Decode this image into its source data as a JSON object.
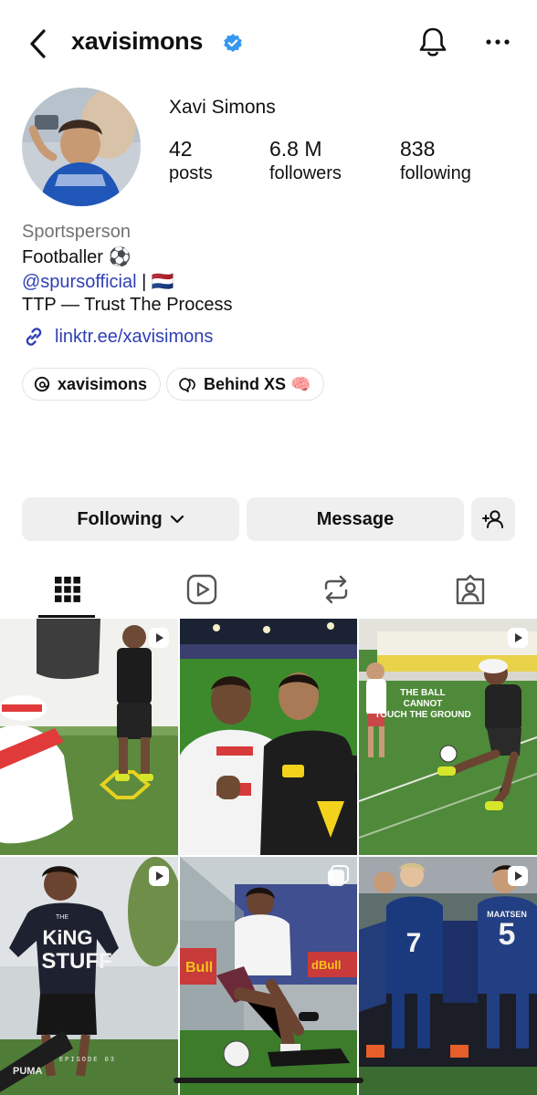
{
  "header": {
    "username": "xavisimons",
    "verified": true,
    "icons": [
      "back-icon",
      "notification-bell-icon",
      "more-options-icon"
    ]
  },
  "profile": {
    "full_name": "Xavi Simons",
    "stats": {
      "posts": {
        "value": "42",
        "label": "posts"
      },
      "followers": {
        "value": "6.8 M",
        "label": "followers"
      },
      "following": {
        "value": "838",
        "label": "following"
      }
    },
    "category": "Sportsperson",
    "bio_line1": "Footballer ⚽",
    "bio_mention": "@spursofficial",
    "bio_separator": " | ",
    "bio_flag": "🇳🇱",
    "bio_line3": "TTP — Trust The Process",
    "link": "linktr.ee/xavisimons"
  },
  "chips": [
    {
      "label": "xavisimons",
      "icon": "threads-icon"
    },
    {
      "label": "Behind XS 🧠",
      "icon": "channel-icon"
    }
  ],
  "actions": {
    "following_label": "Following",
    "message_label": "Message",
    "suggest_icon": "add-person-icon"
  },
  "tabs": [
    {
      "name": "posts-grid",
      "icon": "grid-icon",
      "selected": true
    },
    {
      "name": "reels",
      "icon": "reels-icon",
      "selected": false
    },
    {
      "name": "reposts",
      "icon": "repost-icon",
      "selected": false
    },
    {
      "name": "tagged",
      "icon": "tagged-icon",
      "selected": false
    }
  ],
  "posts": [
    {
      "type": "reel",
      "overlay_text": ""
    },
    {
      "type": "post",
      "overlay_text": ""
    },
    {
      "type": "reel",
      "overlay_text": "THE BALL CANNOT TOUCH THE GROUND"
    },
    {
      "type": "reel",
      "overlay_text": "THE KING STUFF",
      "sub_text": "EPISODE 03",
      "brand": "PUMA"
    },
    {
      "type": "carousel",
      "overlay_text": ""
    },
    {
      "type": "reel",
      "overlay_text": "",
      "jersey_numbers": [
        "7",
        "5"
      ],
      "jersey_name": "MAATSEN"
    }
  ],
  "colors": {
    "accent_link": "#2f3fb5",
    "verified_blue": "#3797f0",
    "button_bg": "#efefef",
    "muted_text": "#737373"
  }
}
